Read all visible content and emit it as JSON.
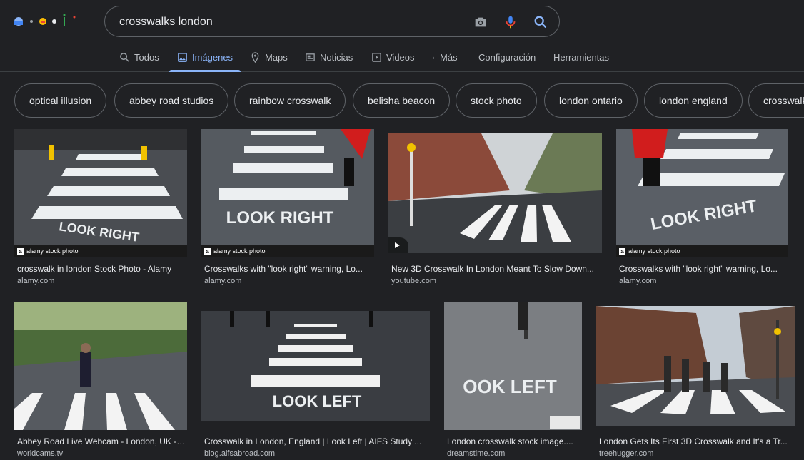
{
  "search": {
    "query": "crosswalks london"
  },
  "tabs": [
    {
      "label": "Todos"
    },
    {
      "label": "Imágenes"
    },
    {
      "label": "Maps"
    },
    {
      "label": "Noticias"
    },
    {
      "label": "Videos"
    },
    {
      "label": "Más"
    },
    {
      "label": "Configuración"
    },
    {
      "label": "Herramientas"
    }
  ],
  "chips": [
    {
      "label": "optical illusion"
    },
    {
      "label": "abbey road studios"
    },
    {
      "label": "rainbow crosswalk"
    },
    {
      "label": "belisha beacon"
    },
    {
      "label": "stock photo"
    },
    {
      "label": "london ontario"
    },
    {
      "label": "london england"
    },
    {
      "label": "crosswalk"
    }
  ],
  "results": [
    {
      "caption": "crosswalk in london Stock Photo - Alamy",
      "site": "alamy.com",
      "badge": "alamy stock photo",
      "road_text": "LOOK RIGHT"
    },
    {
      "caption": "Crosswalks with \"look right\" warning, Lo...",
      "site": "alamy.com",
      "badge": "alamy stock photo",
      "road_text": "LOOK RIGHT"
    },
    {
      "caption": "New 3D Crosswalk In London Meant To Slow Down...",
      "site": "youtube.com"
    },
    {
      "caption": "Crosswalks with \"look right\" warning, Lo...",
      "site": "alamy.com",
      "badge": "alamy stock photo",
      "road_text": "LOOK RIGHT"
    },
    {
      "caption": "Abbey Road Live Webcam - London, UK - ...",
      "site": "worldcams.tv"
    },
    {
      "caption": "Crosswalk in London, England | Look Left | AIFS Study ...",
      "site": "blog.aifsabroad.com",
      "road_text": "LOOK LEFT"
    },
    {
      "caption": "London crosswalk stock image....",
      "site": "dreamstime.com",
      "road_text": "OOK LEFT"
    },
    {
      "caption": "London Gets Its First 3D Crosswalk and It's a Tr...",
      "site": "treehugger.com"
    }
  ]
}
